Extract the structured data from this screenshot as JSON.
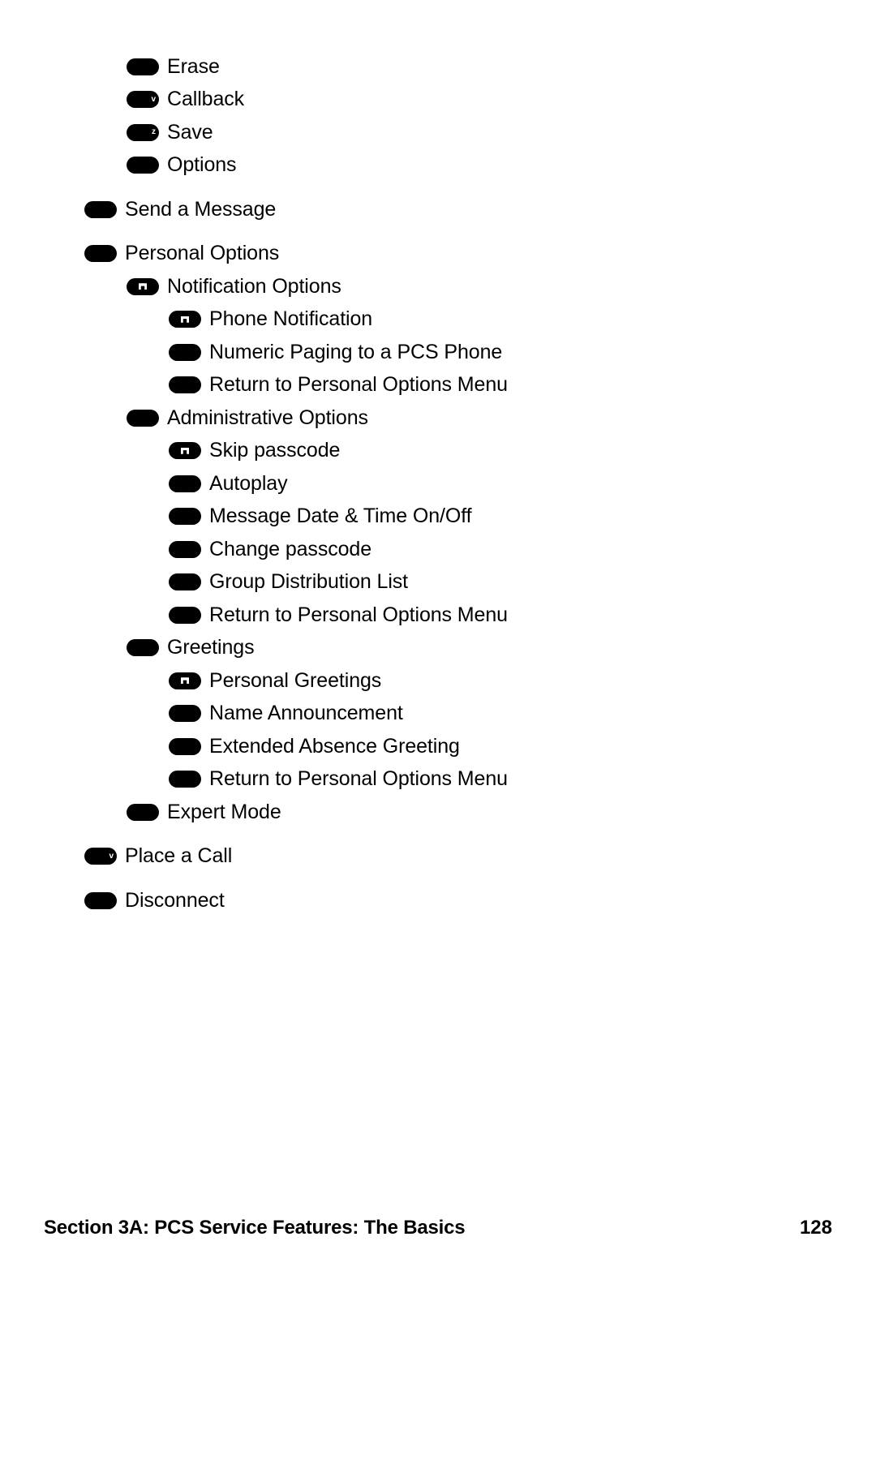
{
  "document": {
    "type": "menu-tree-diagram",
    "background_color": "#ffffff",
    "text_color": "#000000"
  },
  "tree": {
    "items": [
      {
        "label": "Erase",
        "level": 1,
        "marker": "pill",
        "glyph": "",
        "gap_before": false
      },
      {
        "label": "Callback",
        "level": 1,
        "marker": "pill-text",
        "glyph": "v",
        "gap_before": false
      },
      {
        "label": "Save",
        "level": 1,
        "marker": "pill-text",
        "glyph": "z",
        "gap_before": false
      },
      {
        "label": "Options",
        "level": 1,
        "marker": "pill",
        "glyph": "",
        "gap_before": false
      },
      {
        "label": "Send a Message",
        "level": 0,
        "marker": "pill",
        "glyph": "",
        "gap_before": true
      },
      {
        "label": "Personal Options",
        "level": 0,
        "marker": "pill",
        "glyph": "",
        "gap_before": true
      },
      {
        "label": "Notification Options",
        "level": 1,
        "marker": "pill-box",
        "glyph": "w",
        "gap_before": false
      },
      {
        "label": "Phone Notification",
        "level": 2,
        "marker": "pill-box",
        "glyph": "w",
        "gap_before": false
      },
      {
        "label": "Numeric Paging to a PCS Phone",
        "level": 2,
        "marker": "pill",
        "glyph": "",
        "gap_before": false
      },
      {
        "label": "Return to Personal Options Menu",
        "level": 2,
        "marker": "pill",
        "glyph": "",
        "gap_before": false
      },
      {
        "label": "Administrative Options",
        "level": 1,
        "marker": "pill",
        "glyph": "",
        "gap_before": false
      },
      {
        "label": "Skip passcode",
        "level": 2,
        "marker": "pill-box",
        "glyph": "w",
        "gap_before": false
      },
      {
        "label": "Autoplay",
        "level": 2,
        "marker": "pill",
        "glyph": "",
        "gap_before": false
      },
      {
        "label": "Message Date & Time On/Off",
        "level": 2,
        "marker": "pill",
        "glyph": "",
        "gap_before": false
      },
      {
        "label": "Change passcode",
        "level": 2,
        "marker": "pill",
        "glyph": "",
        "gap_before": false
      },
      {
        "label": "Group Distribution List",
        "level": 2,
        "marker": "pill",
        "glyph": "",
        "gap_before": false
      },
      {
        "label": "Return to Personal Options Menu",
        "level": 2,
        "marker": "pill",
        "glyph": "",
        "gap_before": false
      },
      {
        "label": "Greetings",
        "level": 1,
        "marker": "pill",
        "glyph": "",
        "gap_before": false
      },
      {
        "label": "Personal Greetings",
        "level": 2,
        "marker": "pill-box",
        "glyph": "w",
        "gap_before": false
      },
      {
        "label": "Name Announcement",
        "level": 2,
        "marker": "pill",
        "glyph": "",
        "gap_before": false
      },
      {
        "label": "Extended Absence Greeting",
        "level": 2,
        "marker": "pill",
        "glyph": "",
        "gap_before": false
      },
      {
        "label": "Return to Personal Options Menu",
        "level": 2,
        "marker": "pill",
        "glyph": "",
        "gap_before": false
      },
      {
        "label": "Expert Mode",
        "level": 1,
        "marker": "pill",
        "glyph": "",
        "gap_before": false
      },
      {
        "label": "Place a Call",
        "level": 0,
        "marker": "pill-text",
        "glyph": "v",
        "gap_before": true
      },
      {
        "label": "Disconnect",
        "level": 0,
        "marker": "pill",
        "glyph": "",
        "gap_before": true
      }
    ]
  },
  "footer": {
    "title": "Section 3A: PCS Service Features: The Basics",
    "page_number": "128"
  }
}
